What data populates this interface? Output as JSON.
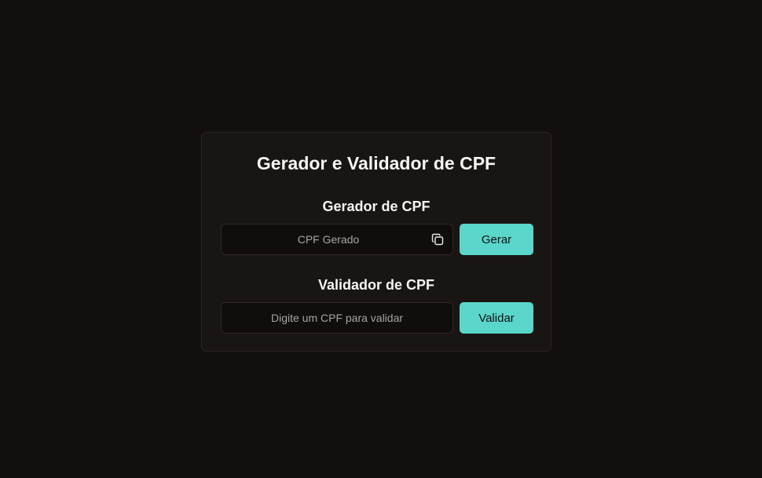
{
  "card": {
    "title": "Gerador e Validador de CPF"
  },
  "generator": {
    "section_title": "Gerador de CPF",
    "field_value": "",
    "field_placeholder": "CPF Gerado",
    "copy_icon": "copy-icon",
    "button_label": "Gerar"
  },
  "validator": {
    "section_title": "Validador de CPF",
    "field_value": "",
    "field_placeholder": "Digite um CPF para validar",
    "button_label": "Validar"
  },
  "colors": {
    "background": "#130f0e",
    "card": "#191513",
    "accent": "#5ad6cb"
  }
}
